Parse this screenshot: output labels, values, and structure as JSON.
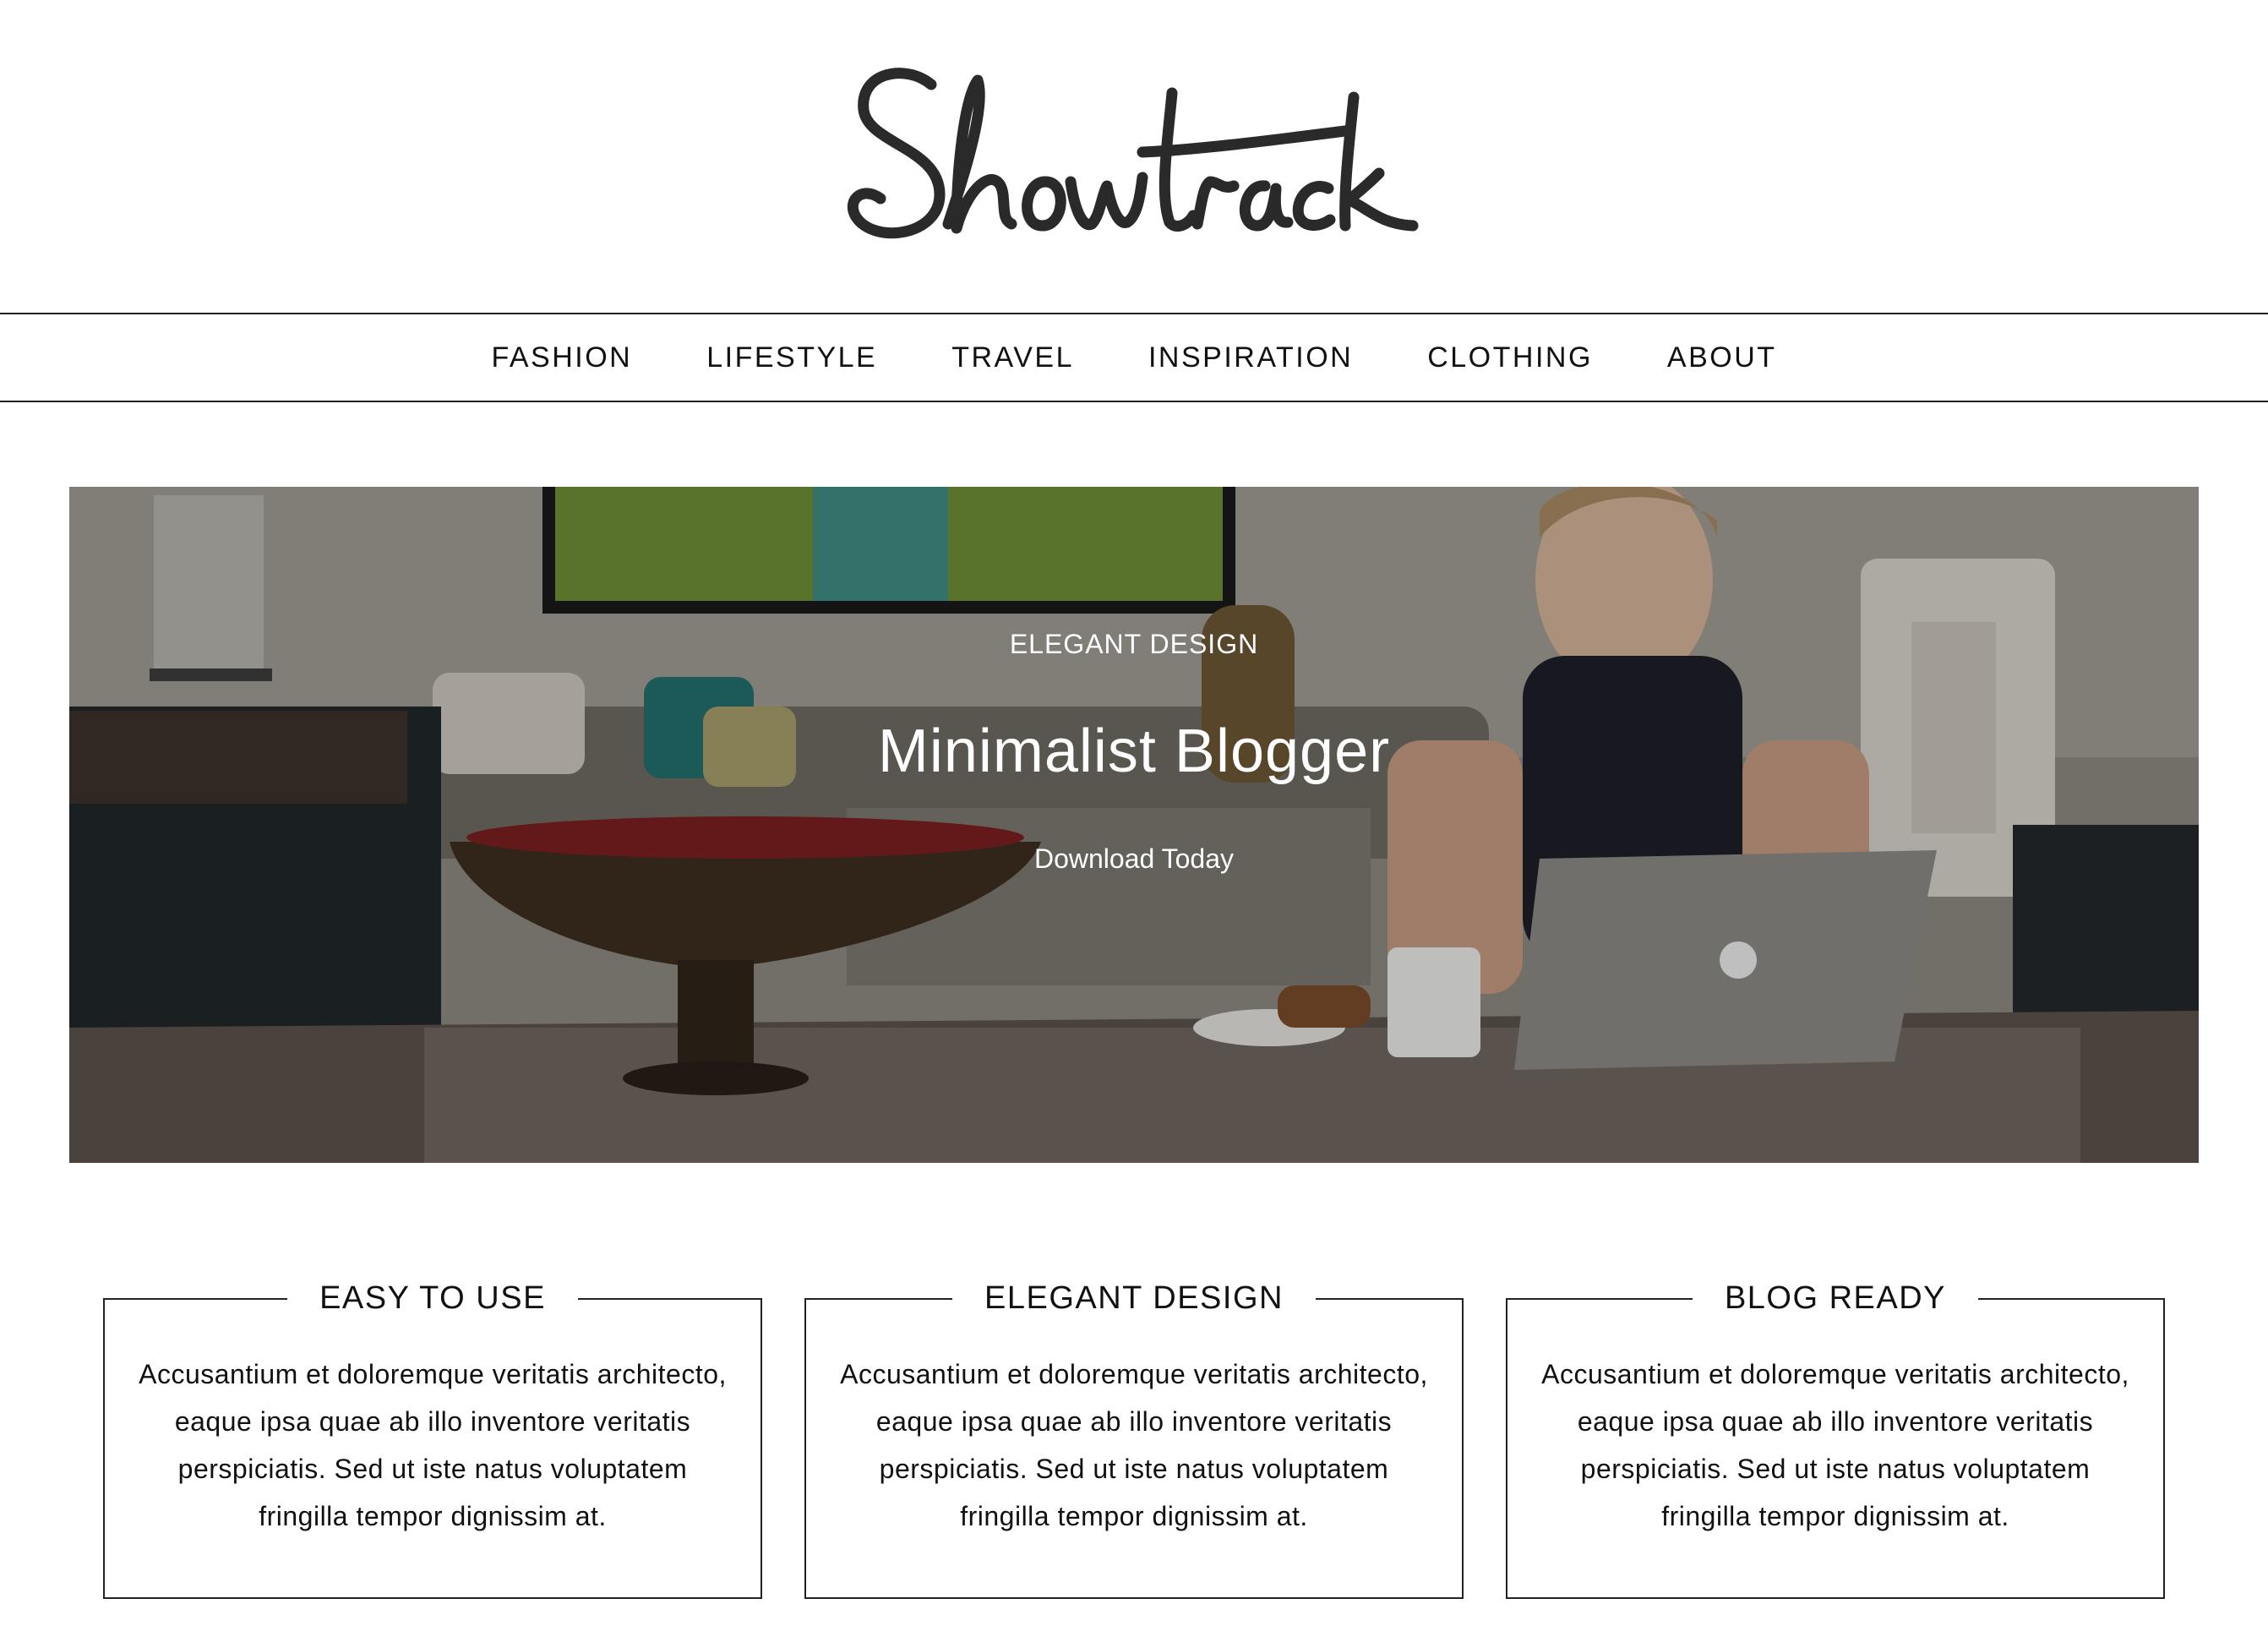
{
  "logo": {
    "text": "Showtrack"
  },
  "nav": {
    "items": [
      "FASHION",
      "LIFESTYLE",
      "TRAVEL",
      "INSPIRATION",
      "CLOTHING",
      "ABOUT"
    ]
  },
  "hero": {
    "kicker": "ELEGANT DESIGN",
    "title": "Minimalist Blogger",
    "cta": "Download Today"
  },
  "features": [
    {
      "title": "EASY TO USE",
      "body": "Accusantium et doloremque veritatis architecto, eaque ipsa quae ab illo inventore veritatis perspiciatis. Sed ut iste natus voluptatem fringilla tempor dignissim at."
    },
    {
      "title": "ELEGANT DESIGN",
      "body": "Accusantium et doloremque veritatis architecto, eaque ipsa quae ab illo inventore veritatis perspiciatis. Sed ut iste natus voluptatem fringilla tempor dignissim at."
    },
    {
      "title": "BLOG READY",
      "body": "Accusantium et doloremque veritatis architecto, eaque ipsa quae ab illo inventore veritatis perspiciatis. Sed ut iste natus voluptatem fringilla tempor dignissim at."
    }
  ],
  "colors": {
    "text": "#111111",
    "border": "#222222",
    "background": "#ffffff",
    "hero_text": "#ffffff"
  }
}
